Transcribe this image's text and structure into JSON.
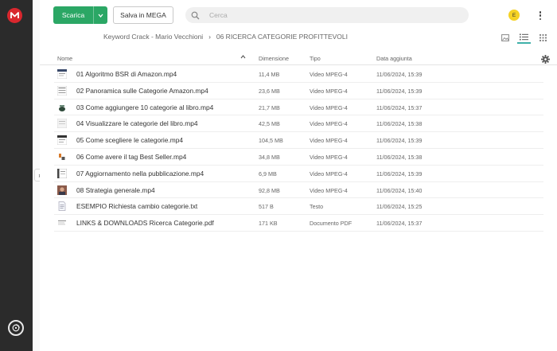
{
  "header": {
    "download_label": "Scarica",
    "save_label": "Salva in MEGA",
    "search_placeholder": "Cerca",
    "avatar_initial": "E"
  },
  "breadcrumb": {
    "parent": "Keyword Crack - Mario Vecchioni",
    "separator": "›",
    "current": "06 RICERCA CATEGORIE PROFITTEVOLI"
  },
  "columns": {
    "name": "Nome",
    "size": "Dimensione",
    "type": "Tipo",
    "date": "Data aggiunta"
  },
  "files": [
    {
      "name": "01 Algoritmo BSR di Amazon.mp4",
      "size": "11,4 MB",
      "type": "Video MPEG-4",
      "date": "11/06/2024, 15:39"
    },
    {
      "name": "02 Panoramica sulle Categorie Amazon.mp4",
      "size": "23,6 MB",
      "type": "Video MPEG-4",
      "date": "11/06/2024, 15:39"
    },
    {
      "name": "03 Come aggiungere 10 categorie al libro.mp4",
      "size": "21,7 MB",
      "type": "Video MPEG-4",
      "date": "11/06/2024, 15:37"
    },
    {
      "name": "04 Visualizzare le categorie del libro.mp4",
      "size": "42,5 MB",
      "type": "Video MPEG-4",
      "date": "11/06/2024, 15:38"
    },
    {
      "name": "05 Come scegliere le categorie.mp4",
      "size": "104,5 MB",
      "type": "Video MPEG-4",
      "date": "11/06/2024, 15:39"
    },
    {
      "name": "06 Come avere il tag Best Seller.mp4",
      "size": "34,8 MB",
      "type": "Video MPEG-4",
      "date": "11/06/2024, 15:38"
    },
    {
      "name": "07 Aggiornamento nella pubblicazione.mp4",
      "size": "6,9 MB",
      "type": "Video MPEG-4",
      "date": "11/06/2024, 15:39"
    },
    {
      "name": "08 Strategia generale.mp4",
      "size": "92,8 MB",
      "type": "Video MPEG-4",
      "date": "11/06/2024, 15:40"
    },
    {
      "name": "ESEMPIO Richiesta cambio categorie.txt",
      "size": "517 B",
      "type": "Testo",
      "date": "11/06/2024, 15:25"
    },
    {
      "name": "LINKS & DOWNLOADS Ricerca Categorie.pdf",
      "size": "171 KB",
      "type": "Documento PDF",
      "date": "11/06/2024, 15:37"
    }
  ],
  "colors": {
    "download_green": "#2ba765",
    "brand_red": "#d9272e",
    "rail": "#2b2b2b",
    "avatar_yellow": "#f5d224",
    "active_view": "#3fb0a9"
  }
}
